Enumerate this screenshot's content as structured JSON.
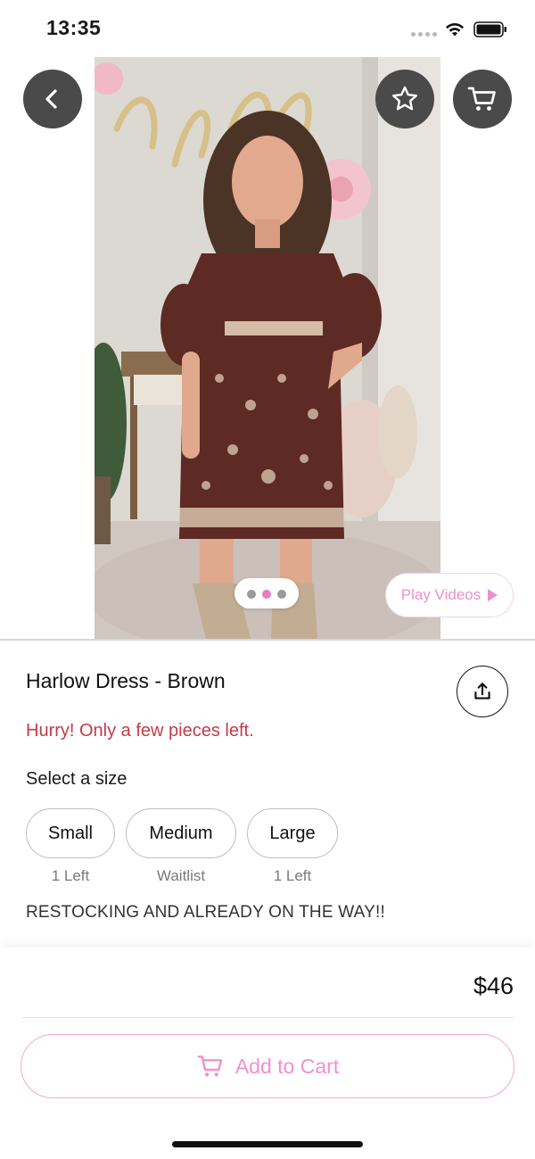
{
  "status_bar": {
    "time": "13:35",
    "icons": [
      "signal-dots-icon",
      "wifi-icon",
      "battery-icon"
    ]
  },
  "header": {
    "back_icon": "chevron-left-icon",
    "favorite_icon": "star-icon",
    "cart_icon": "cart-icon"
  },
  "gallery": {
    "image_count": 3,
    "active_index": 1,
    "play_videos_label": "Play Videos"
  },
  "product": {
    "title": "Harlow Dress - Brown",
    "stock_warning": "Hurry! Only a few pieces left.",
    "size_label": "Select a size",
    "sizes": [
      {
        "label": "Small",
        "note": "1 Left"
      },
      {
        "label": "Medium",
        "note": "Waitlist"
      },
      {
        "label": "Large",
        "note": "1 Left"
      }
    ],
    "restock_note": "RESTOCKING AND ALREADY ON THE WAY!!",
    "share_icon": "share-icon"
  },
  "footer": {
    "price": "$46",
    "add_to_cart_label": "Add to Cart"
  },
  "colors": {
    "accent_pink": "#f28fd0",
    "warning_red": "#c33a4a",
    "icon_button_bg": "#4a4a4a"
  }
}
